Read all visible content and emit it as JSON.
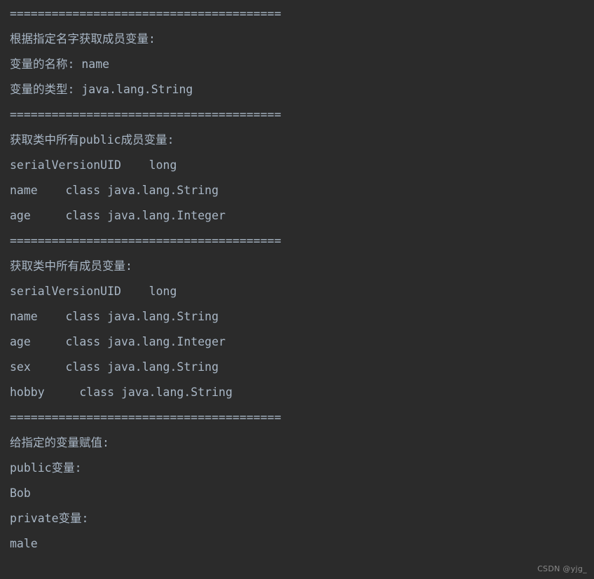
{
  "console": {
    "background_color": "#2b2b2b",
    "text_color": "#a9b7c6",
    "separator": "=======================================",
    "lines": [
      {
        "id": "sep-1",
        "kind": "separator",
        "text": "======================================="
      },
      {
        "id": "l-1",
        "kind": "text",
        "text": "根据指定名字获取成员变量:"
      },
      {
        "id": "l-2",
        "kind": "text",
        "text": "变量的名称: name"
      },
      {
        "id": "l-3",
        "kind": "text",
        "text": "变量的类型: java.lang.String"
      },
      {
        "id": "sep-2",
        "kind": "separator",
        "text": "======================================="
      },
      {
        "id": "l-4",
        "kind": "text",
        "text": "获取类中所有public成员变量:"
      },
      {
        "id": "l-5",
        "kind": "text",
        "text": "serialVersionUID    long"
      },
      {
        "id": "l-6",
        "kind": "text",
        "text": "name    class java.lang.String"
      },
      {
        "id": "l-7",
        "kind": "text",
        "text": "age     class java.lang.Integer"
      },
      {
        "id": "sep-3",
        "kind": "separator",
        "text": "======================================="
      },
      {
        "id": "l-8",
        "kind": "text",
        "text": "获取类中所有成员变量:"
      },
      {
        "id": "l-9",
        "kind": "text",
        "text": "serialVersionUID    long"
      },
      {
        "id": "l-10",
        "kind": "text",
        "text": "name    class java.lang.String"
      },
      {
        "id": "l-11",
        "kind": "text",
        "text": "age     class java.lang.Integer"
      },
      {
        "id": "l-12",
        "kind": "text",
        "text": "sex     class java.lang.String"
      },
      {
        "id": "l-13",
        "kind": "text",
        "text": "hobby     class java.lang.String"
      },
      {
        "id": "sep-4",
        "kind": "separator",
        "text": "======================================="
      },
      {
        "id": "l-14",
        "kind": "text",
        "text": "给指定的变量赋值:"
      },
      {
        "id": "l-15",
        "kind": "text",
        "text": "public变量:"
      },
      {
        "id": "l-16",
        "kind": "text",
        "text": "Bob"
      },
      {
        "id": "l-17",
        "kind": "text",
        "text": "private变量:"
      },
      {
        "id": "l-18",
        "kind": "text",
        "text": "male"
      }
    ]
  },
  "watermark": {
    "text": "CSDN @yjg_"
  }
}
